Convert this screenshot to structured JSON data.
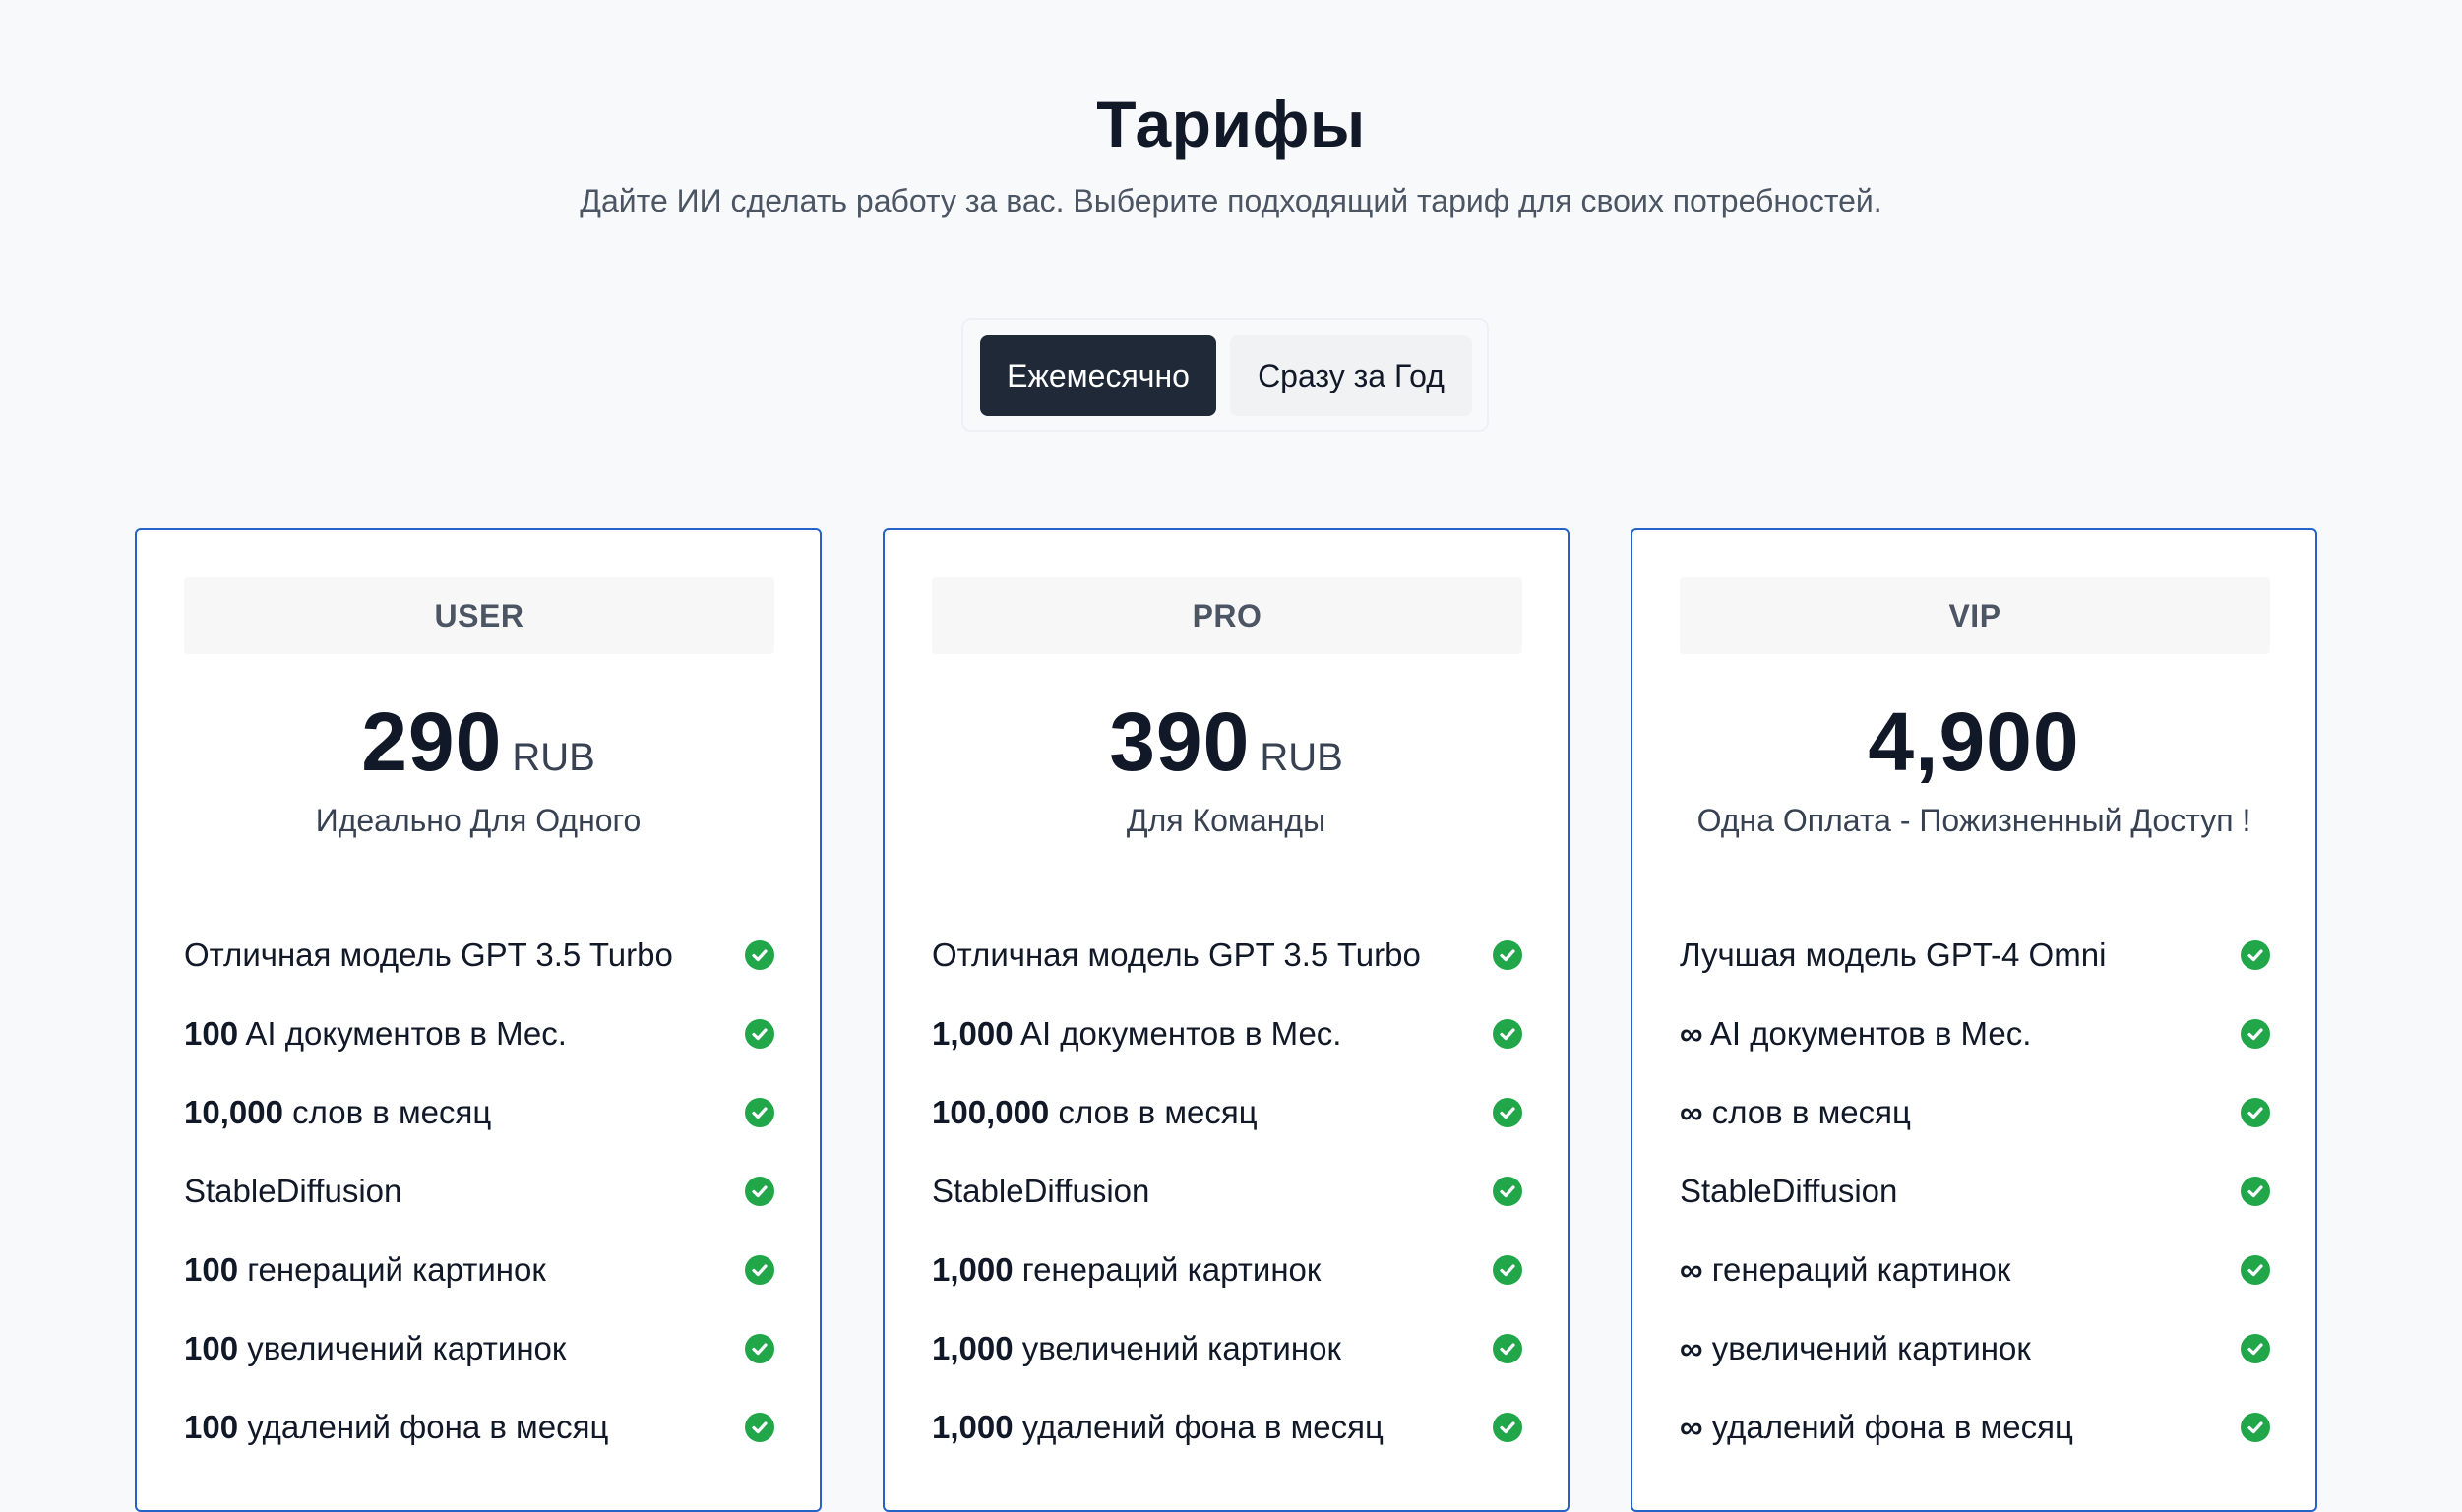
{
  "header": {
    "title": "Тарифы",
    "subtitle": "Дайте ИИ сделать работу за вас. Выберите подходящий тариф для своих потребностей."
  },
  "billing_toggle": {
    "monthly_label": "Ежемесячно",
    "yearly_label": "Сразу за Год",
    "selected": "monthly"
  },
  "colors": {
    "accent_border": "#2563c7",
    "check": "#22a64a",
    "active_toggle": "#1f2937"
  },
  "plans": [
    {
      "name": "USER",
      "price": "290",
      "currency": "RUB",
      "description": "Идеально Для Одного",
      "features": [
        {
          "bold": "",
          "text": "Отличная модель GPT 3.5 Turbo",
          "icon": "check-circle-icon"
        },
        {
          "bold": "100",
          "text": " AI документов в Мес.",
          "icon": "check-circle-icon"
        },
        {
          "bold": "10,000",
          "text": " слов в месяц",
          "icon": "check-circle-icon"
        },
        {
          "bold": "",
          "text": "StableDiffusion",
          "icon": "check-circle-icon"
        },
        {
          "bold": "100",
          "text": " генераций картинок",
          "icon": "check-circle-icon"
        },
        {
          "bold": "100",
          "text": " увеличений картинок",
          "icon": "check-circle-icon"
        },
        {
          "bold": "100",
          "text": " удалений фона в месяц",
          "icon": "check-circle-icon"
        }
      ]
    },
    {
      "name": "PRO",
      "price": "390",
      "currency": "RUB",
      "description": "Для Команды",
      "features": [
        {
          "bold": "",
          "text": "Отличная модель GPT 3.5 Turbo",
          "icon": "check-circle-icon"
        },
        {
          "bold": "1,000",
          "text": " AI документов в Мес.",
          "icon": "check-circle-icon"
        },
        {
          "bold": "100,000",
          "text": " слов в месяц",
          "icon": "check-circle-icon"
        },
        {
          "bold": "",
          "text": "StableDiffusion",
          "icon": "check-circle-icon"
        },
        {
          "bold": "1,000",
          "text": " генераций картинок",
          "icon": "check-circle-icon"
        },
        {
          "bold": "1,000",
          "text": " увеличений картинок",
          "icon": "check-circle-icon"
        },
        {
          "bold": "1,000",
          "text": " удалений фона в месяц",
          "icon": "check-circle-icon"
        }
      ]
    },
    {
      "name": "VIP",
      "price": "4,900",
      "currency": "",
      "description": "Одна Оплата - Пожизненный Доступ !",
      "features": [
        {
          "bold": "",
          "text": "Лучшая модель GPT-4 Omni",
          "icon": "check-circle-icon"
        },
        {
          "bold": "∞",
          "text": " AI документов в Мес.",
          "icon": "check-circle-icon"
        },
        {
          "bold": "∞",
          "text": " слов в месяц",
          "icon": "check-circle-icon"
        },
        {
          "bold": "",
          "text": "StableDiffusion",
          "icon": "check-circle-icon"
        },
        {
          "bold": "∞",
          "text": " генераций картинок",
          "icon": "check-circle-icon"
        },
        {
          "bold": "∞",
          "text": " увеличений картинок",
          "icon": "check-circle-icon"
        },
        {
          "bold": "∞",
          "text": " удалений фона в месяц",
          "icon": "check-circle-icon"
        }
      ]
    }
  ]
}
